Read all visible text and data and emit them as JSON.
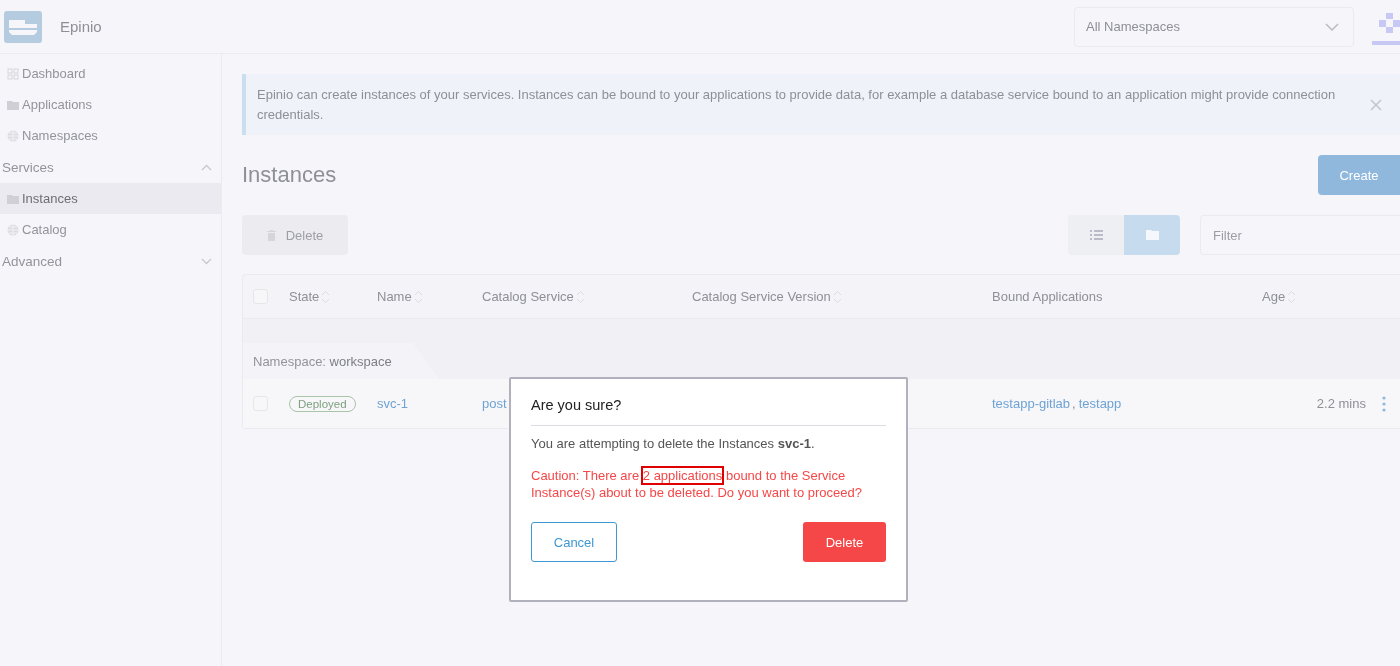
{
  "header": {
    "brand": "Epinio",
    "namespace_select": "All Namespaces"
  },
  "sidebar": {
    "items": [
      {
        "kind": "link",
        "label": "Dashboard",
        "selected": false
      },
      {
        "kind": "link",
        "label": "Applications",
        "selected": false
      },
      {
        "kind": "link",
        "label": "Namespaces",
        "selected": false
      },
      {
        "kind": "group",
        "label": "Services",
        "expanded": true
      },
      {
        "kind": "link",
        "label": "Instances",
        "selected": true
      },
      {
        "kind": "link",
        "label": "Catalog",
        "selected": false
      },
      {
        "kind": "group",
        "label": "Advanced",
        "expanded": false
      }
    ]
  },
  "banner": {
    "text": "Epinio can create instances of your services. Instances can be bound to your applications to provide data, for example a database service bound to an application might provide connection credentials."
  },
  "page_title": "Instances",
  "create_button": "Create",
  "delete_button": "Delete",
  "view_toggle": [
    {
      "selected": false
    },
    {
      "selected": true
    }
  ],
  "filter": {
    "placeholder": "Filter"
  },
  "table": {
    "select_all_checked": false,
    "columns": [
      {
        "label": "State",
        "sortable": true
      },
      {
        "label": "Name",
        "sortable": true
      },
      {
        "label": "Catalog Service",
        "sortable": true
      },
      {
        "label": "Catalog Service Version",
        "sortable": true
      },
      {
        "label": "Bound Applications",
        "sortable": false
      },
      {
        "label": "Age",
        "sortable": true
      }
    ],
    "group": {
      "label": "Namespace:",
      "value": "workspace"
    },
    "rows": [
      {
        "checked": false,
        "state": "Deployed",
        "name": "svc-1",
        "catalog_service": "post",
        "bound_applications": [
          "testapp-gitlab",
          "testapp"
        ],
        "separator": ",",
        "age": "2.2 mins"
      }
    ]
  },
  "dialog": {
    "title": "Are you sure?",
    "message": "You are attempting to delete the Instances **svc-1**.",
    "caution": {
      "before": "Caution: There are",
      "highlight": "2 applications",
      "after": "bound to the Service Instance(s) about to be deleted. Do you want to proceed?"
    },
    "cancel": "Cancel",
    "confirm": "Delete"
  }
}
